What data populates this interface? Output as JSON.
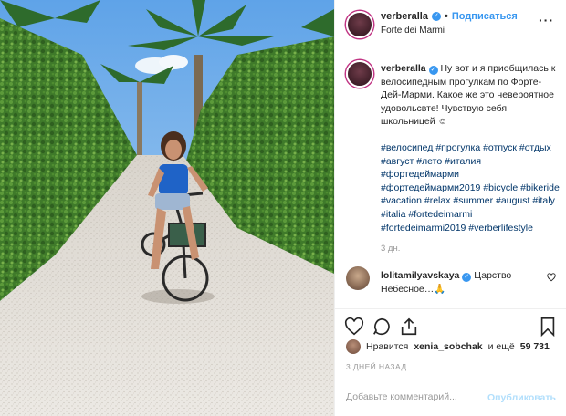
{
  "post": {
    "username": "verberalla",
    "follow_label": "Подписаться",
    "separator": "•",
    "location": "Forte dei Marmi",
    "more_label": "···",
    "caption_text": "Ну вот и я приобщилась к велосипедным прогулкам по Форте-Дей-Марми. Какое же это невероятное удовольсвте! Чувствую себя школьницей ☺",
    "hashtags": "#велосипед #прогулка #отпуск #отдых #август #лето #италия #фортедеймарми #фортедеймарми2019 #bicycle #bikeride #vacation #relax #summer #august #italy #italia #fortedeimarmi #fortedeimarmi2019 #verberlifestyle",
    "age": "3 дн."
  },
  "comment": {
    "username": "lolitamilyavskaya",
    "text": "Царство Небесное…🙏"
  },
  "likes": {
    "prefix": "Нравится",
    "user": "xenia_sobchak",
    "middle": "и ещё",
    "count": "59 731"
  },
  "posted_ago": "3 ДНЕЙ НАЗАД",
  "comment_input": {
    "placeholder": "Добавьте комментарий...",
    "publish_label": "Опубликовать"
  },
  "colors": {
    "link_blue": "#3897f0",
    "hashtag": "#003569",
    "muted": "#999999",
    "publish_disabled": "#b2dffc"
  },
  "icons": [
    "verified-icon",
    "more-options-icon",
    "heart-icon",
    "comment-icon",
    "share-icon",
    "bookmark-icon",
    "small-heart-icon"
  ]
}
